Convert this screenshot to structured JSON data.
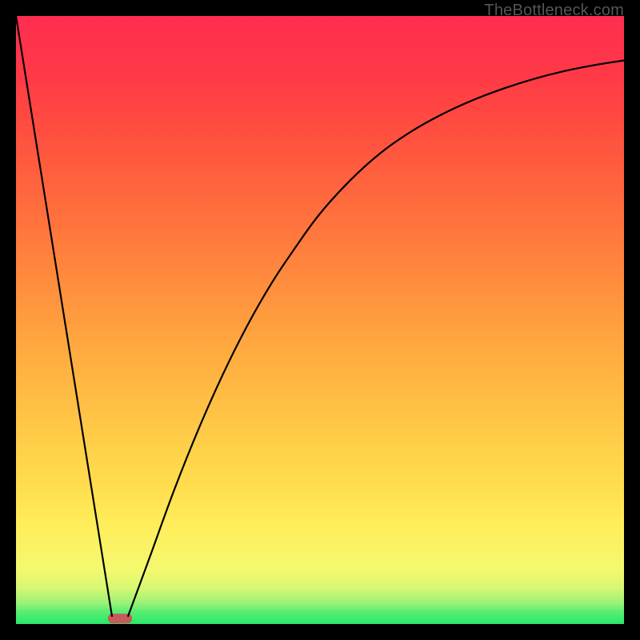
{
  "watermark": "TheBottleneck.com",
  "chart_data": {
    "type": "line",
    "title": "",
    "xlabel": "",
    "ylabel": "",
    "xlim": [
      0,
      100
    ],
    "ylim": [
      0,
      100
    ],
    "grid": false,
    "legend": false,
    "series": [
      {
        "name": "left-line",
        "x": [
          0,
          15.8
        ],
        "values": [
          100,
          1.2
        ]
      },
      {
        "name": "right-curve",
        "x": [
          18.4,
          22,
          26,
          30,
          34,
          38,
          42,
          46,
          50,
          55,
          60,
          65,
          70,
          75,
          80,
          85,
          90,
          95,
          100
        ],
        "values": [
          1.2,
          11,
          22,
          32,
          41,
          49,
          56,
          62,
          67.5,
          73,
          77.5,
          81,
          83.8,
          86.1,
          88,
          89.6,
          90.9,
          91.9,
          92.7
        ]
      }
    ],
    "marker": {
      "x_start": 15.1,
      "x_end": 19.1,
      "y": 0.9,
      "height": 1.6,
      "rx": 0.8,
      "color": "#c85a5c"
    },
    "line_color": "#000000",
    "line_width": 2.2
  }
}
